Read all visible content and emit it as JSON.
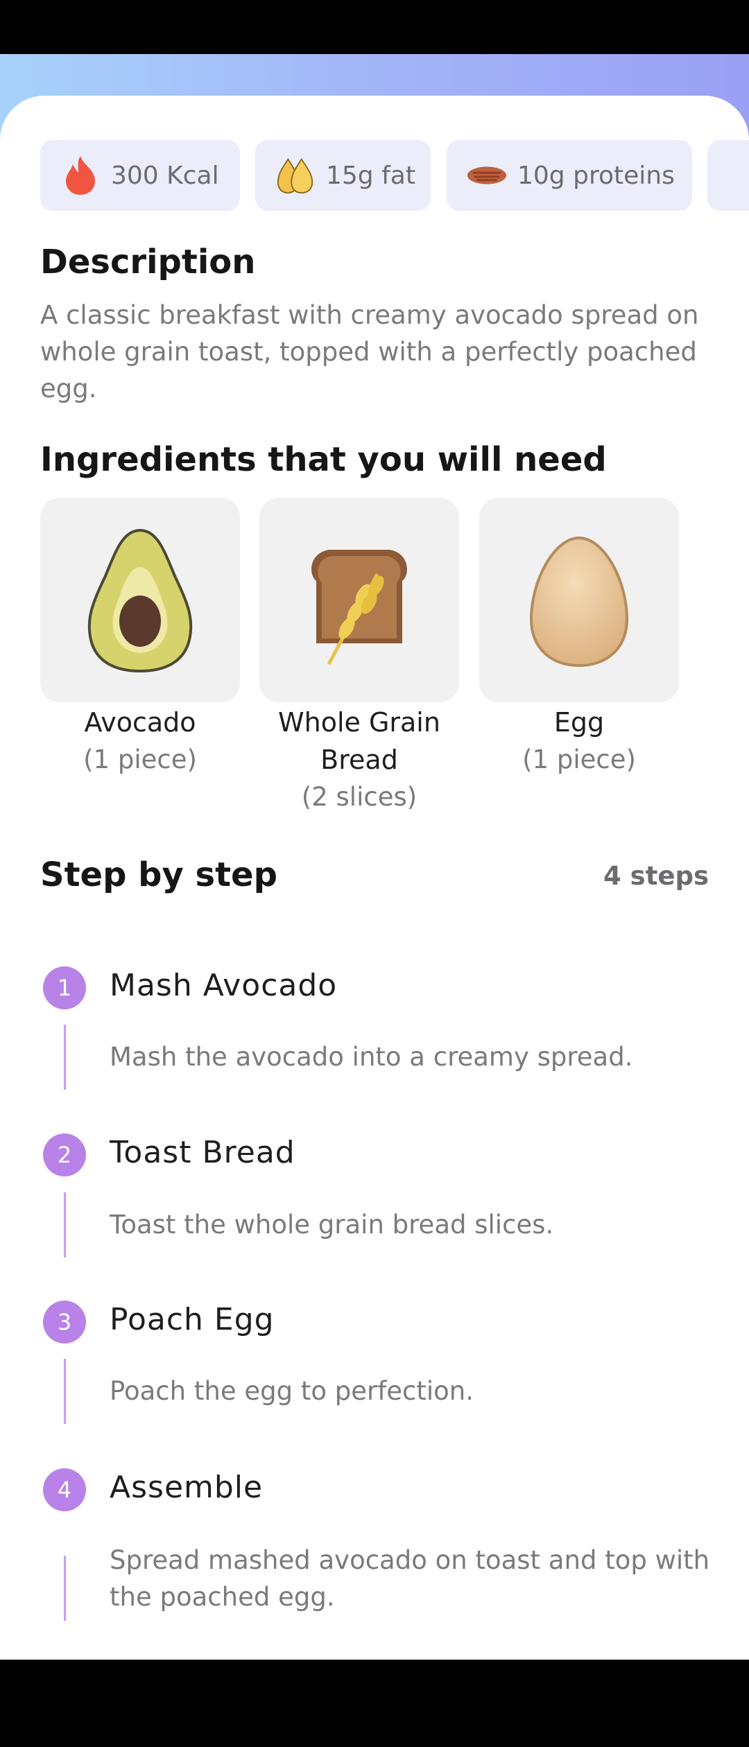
{
  "nutrition": [
    {
      "icon": "flame-icon",
      "label": "300 Kcal"
    },
    {
      "icon": "fat-drops-icon",
      "label": "15g fat"
    },
    {
      "icon": "steak-icon",
      "label": "10g proteins"
    }
  ],
  "description": {
    "heading": "Description",
    "text": "A classic breakfast with creamy avocado spread on whole grain toast, topped with a perfectly poached egg."
  },
  "ingredients": {
    "heading": "Ingredients that you will need",
    "items": [
      {
        "icon": "avocado-icon",
        "name": "Avocado",
        "qty": "(1 piece)"
      },
      {
        "icon": "bread-icon",
        "name": "Whole Grain Bread",
        "qty": "(2 slices)"
      },
      {
        "icon": "egg-icon",
        "name": "Egg",
        "qty": "(1 piece)"
      }
    ]
  },
  "steps": {
    "heading": "Step by step",
    "count_label": "4 steps",
    "items": [
      {
        "num": "1",
        "title": "Mash Avocado",
        "desc": "Mash the avocado into a creamy spread."
      },
      {
        "num": "2",
        "title": "Toast Bread",
        "desc": "Toast the whole grain bread slices."
      },
      {
        "num": "3",
        "title": "Poach Egg",
        "desc": "Poach the egg to perfection."
      },
      {
        "num": "4",
        "title": "Assemble",
        "desc": "Spread mashed avocado on toast and top with the poached egg."
      }
    ]
  },
  "colors": {
    "accent": "#b982e8",
    "chip_bg": "#ebedfb",
    "card_bg": "#f1f1f1"
  }
}
